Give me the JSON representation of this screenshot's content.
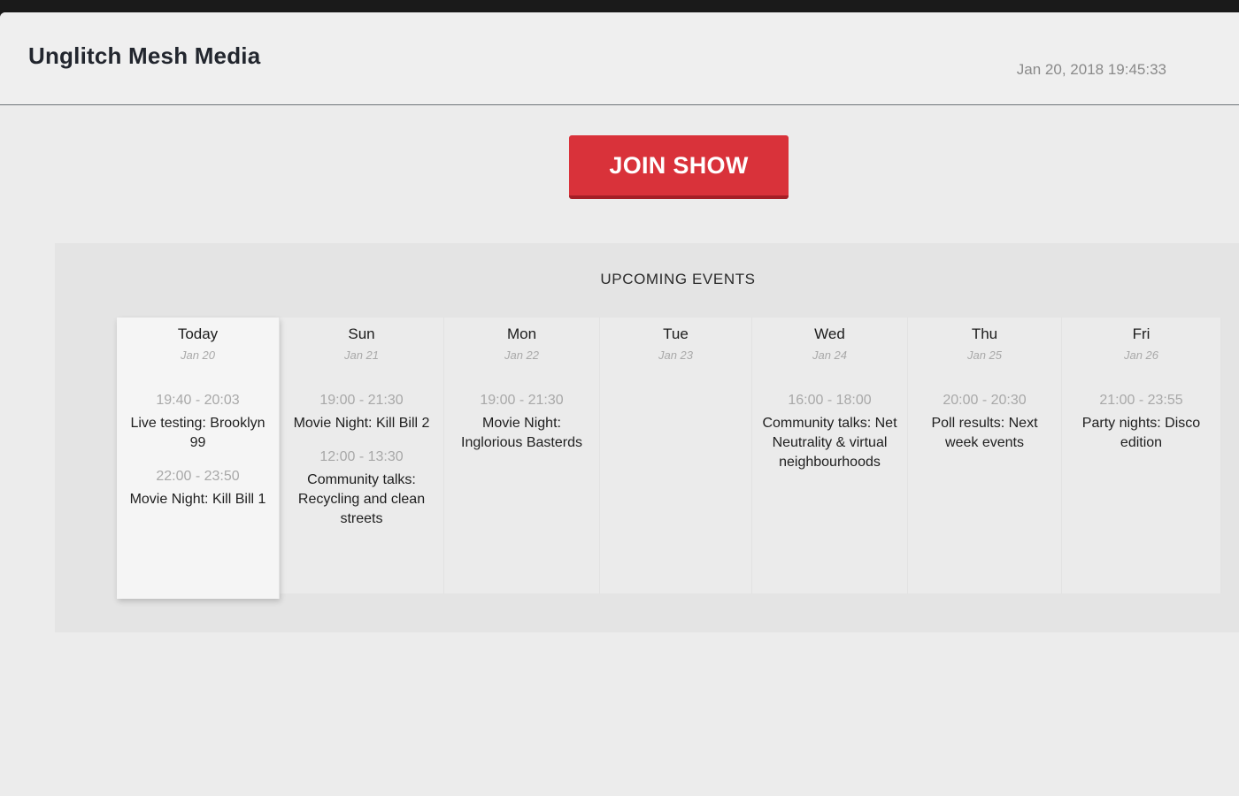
{
  "app": {
    "title": "Unglitch Mesh Media",
    "datetime": "Jan 20, 2018 19:45:33"
  },
  "join_button": {
    "label": "JOIN SHOW"
  },
  "events": {
    "heading": "UPCOMING EVENTS",
    "days": [
      {
        "name": "Today",
        "date": "Jan 20",
        "events": [
          {
            "time": "19:40 - 20:03",
            "title": "Live testing: Brooklyn 99"
          },
          {
            "time": "22:00 - 23:50",
            "title": "Movie Night: Kill Bill 1"
          }
        ]
      },
      {
        "name": "Sun",
        "date": "Jan 21",
        "events": [
          {
            "time": "19:00 - 21:30",
            "title": "Movie Night: Kill Bill 2"
          },
          {
            "time": "12:00 - 13:30",
            "title": "Community talks: Recycling and clean streets"
          }
        ]
      },
      {
        "name": "Mon",
        "date": "Jan 22",
        "events": [
          {
            "time": "19:00 - 21:30",
            "title": "Movie Night: Inglorious Basterds"
          }
        ]
      },
      {
        "name": "Tue",
        "date": "Jan 23",
        "events": []
      },
      {
        "name": "Wed",
        "date": "Jan 24",
        "events": [
          {
            "time": "16:00 - 18:00",
            "title": "Community talks: Net Neutrality & virtual neighbourhoods"
          }
        ]
      },
      {
        "name": "Thu",
        "date": "Jan 25",
        "events": [
          {
            "time": "20:00 - 20:30",
            "title": "Poll results: Next week events"
          }
        ]
      },
      {
        "name": "Fri",
        "date": "Jan 26",
        "events": [
          {
            "time": "21:00 - 23:55",
            "title": "Party nights: Disco edition"
          }
        ]
      }
    ]
  },
  "colors": {
    "accent": "#d9323a",
    "background": "#ececec",
    "text": "#22262e",
    "muted": "#a8a8a8"
  }
}
